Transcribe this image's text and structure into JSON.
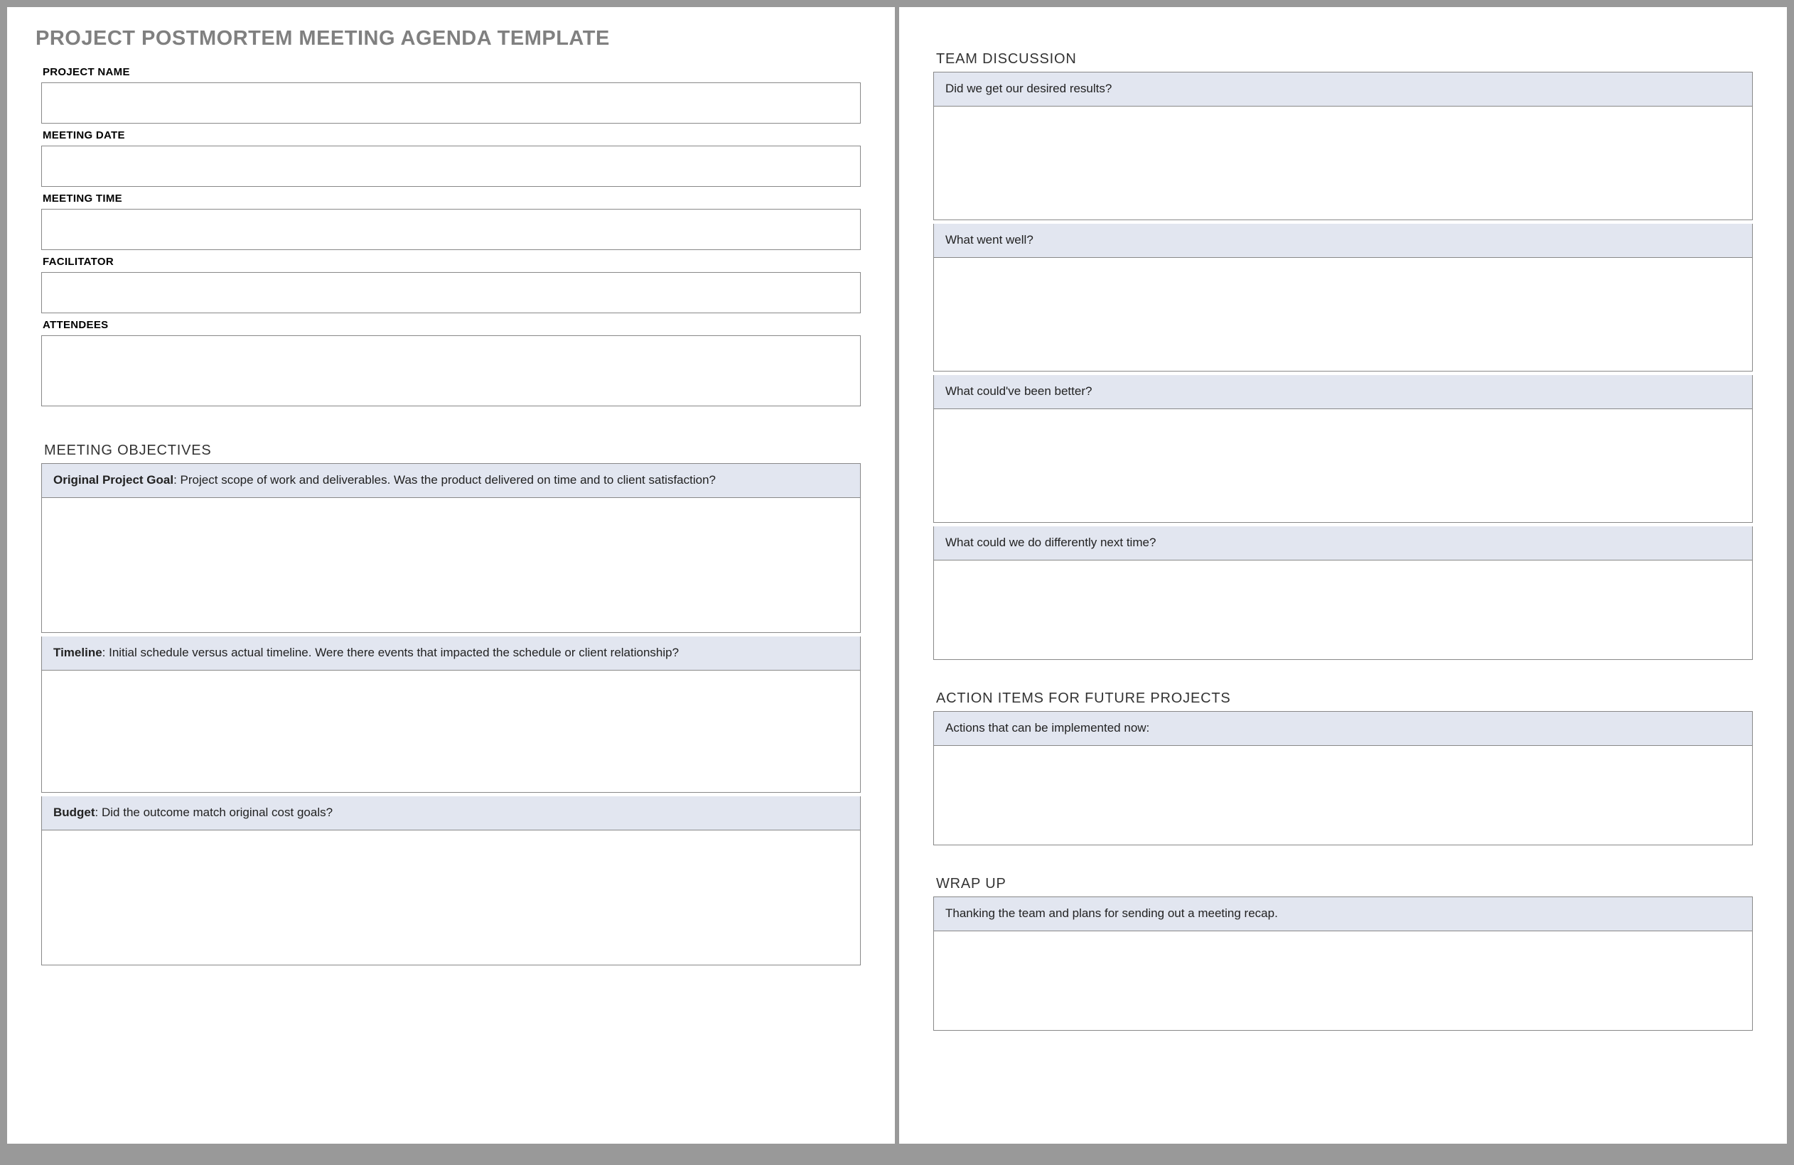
{
  "doc_title": "PROJECT POSTMORTEM MEETING AGENDA TEMPLATE",
  "fields": {
    "project_name": {
      "label": "PROJECT NAME",
      "value": ""
    },
    "meeting_date": {
      "label": "MEETING DATE",
      "value": ""
    },
    "meeting_time": {
      "label": "MEETING TIME",
      "value": ""
    },
    "facilitator": {
      "label": "FACILITATOR",
      "value": ""
    },
    "attendees": {
      "label": "ATTENDEES",
      "value": ""
    }
  },
  "meeting_objectives": {
    "title": "MEETING OBJECTIVES",
    "items": [
      {
        "bold": "Original Project Goal",
        "text": ": Project scope of work and deliverables. Was the product delivered on time and to client satisfaction?",
        "value": ""
      },
      {
        "bold": "Timeline",
        "text": ": Initial schedule versus actual timeline. Were there events that impacted the schedule or client relationship?",
        "value": ""
      },
      {
        "bold": "Budget",
        "text": ": Did the outcome match original cost goals?",
        "value": ""
      }
    ]
  },
  "team_discussion": {
    "title": "TEAM DISCUSSION",
    "items": [
      {
        "prompt": "Did we get our desired results?",
        "value": ""
      },
      {
        "prompt": "What went well?",
        "value": ""
      },
      {
        "prompt": "What could've been better?",
        "value": ""
      },
      {
        "prompt": "What could we do differently next time?",
        "value": ""
      }
    ]
  },
  "action_items": {
    "title": "ACTION ITEMS FOR FUTURE PROJECTS",
    "prompt": "Actions that can be implemented now:",
    "value": ""
  },
  "wrap_up": {
    "title": "WRAP UP",
    "prompt": "Thanking the team and plans for sending out a meeting recap.",
    "value": ""
  }
}
